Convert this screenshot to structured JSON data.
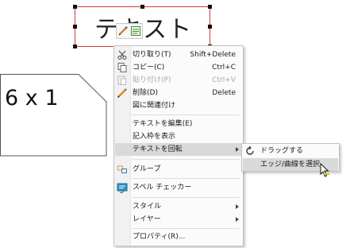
{
  "canvas": {
    "selected_text": "テキスト",
    "shape_text": "6 x 1"
  },
  "mini_toolbar": {
    "icons": [
      "pencil-icon",
      "format-icon"
    ]
  },
  "context_menu": {
    "items": [
      {
        "label": "切り取り(T)",
        "shortcut": "Shift+Delete",
        "icon": "scissors-icon",
        "disabled": false
      },
      {
        "label": "コピー(C)",
        "shortcut": "Ctrl+C",
        "icon": "copy-icon",
        "disabled": false
      },
      {
        "label": "貼り付け(P)",
        "shortcut": "Ctrl+V",
        "icon": "paste-icon",
        "disabled": true
      },
      {
        "label": "削除(D)",
        "shortcut": "Delete",
        "icon": "delete-pencil-icon",
        "disabled": false
      },
      {
        "label": "図に関連付け",
        "shortcut": "",
        "icon": "",
        "disabled": false
      },
      {
        "label": "テキストを編集(E)",
        "shortcut": "",
        "icon": "",
        "disabled": false
      },
      {
        "label": "記入枠を表示",
        "shortcut": "",
        "icon": "",
        "disabled": false
      },
      {
        "label": "テキストを回転",
        "shortcut": "",
        "icon": "",
        "disabled": false,
        "submenu": true,
        "highlighted": true
      },
      {
        "label": "グループ",
        "shortcut": "",
        "icon": "group-icon",
        "disabled": false
      },
      {
        "label": "スペル チェッカー",
        "shortcut": "",
        "icon": "spellcheck-icon",
        "disabled": false
      },
      {
        "label": "スタイル",
        "shortcut": "",
        "icon": "",
        "disabled": false,
        "submenu": true
      },
      {
        "label": "レイヤー",
        "shortcut": "",
        "icon": "",
        "disabled": false,
        "submenu": true
      },
      {
        "label": "プロパティ(R)...",
        "shortcut": "",
        "icon": "",
        "disabled": false
      }
    ]
  },
  "submenu": {
    "items": [
      {
        "label": "ドラッグする",
        "icon": "rotate-icon"
      },
      {
        "label": "エッジ/曲線を選択",
        "icon": "",
        "highlighted": true
      }
    ]
  },
  "colors": {
    "selection_border": "#d83a3a",
    "menu_highlight": "#d9d9d9",
    "disabled_text": "#a8a8a8"
  }
}
